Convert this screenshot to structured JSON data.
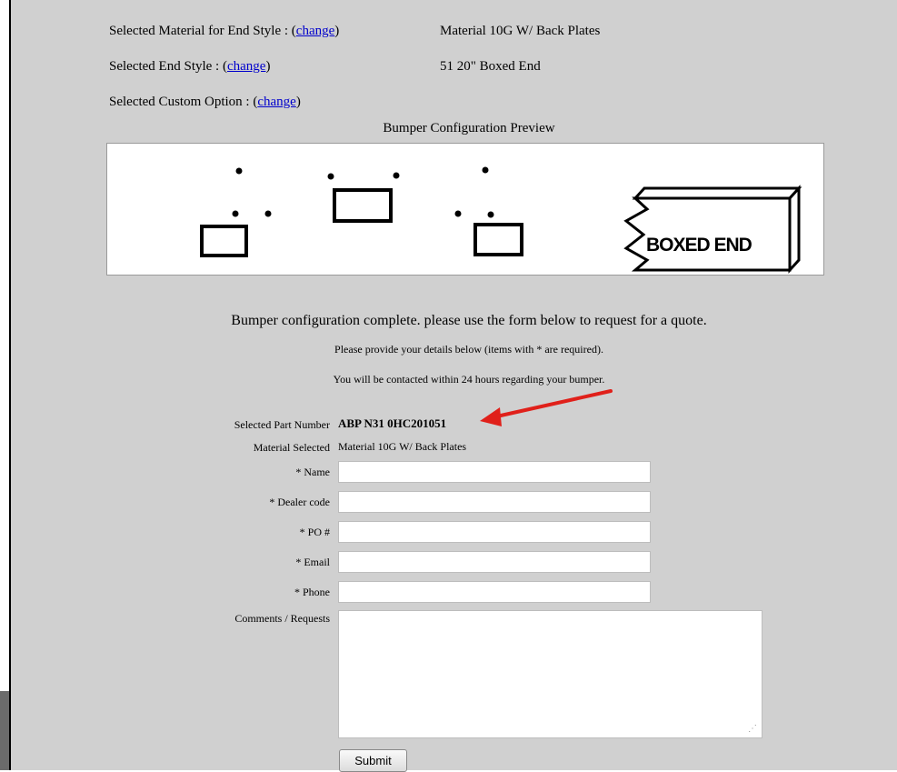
{
  "selections": [
    {
      "label": "Selected Material for End Style : (",
      "link": "change",
      "close": ")",
      "value": "Material 10G W/ Back Plates"
    },
    {
      "label": "Selected End Style : (",
      "link": "change",
      "close": ")",
      "value": "51 20\" Boxed End"
    },
    {
      "label": "Selected Custom Option : (",
      "link": "change",
      "close": ")",
      "value": ""
    }
  ],
  "preview": {
    "title": "Bumper Configuration Preview",
    "boxed_end_label": "BOXED END"
  },
  "messages": {
    "complete": "Bumper configuration complete. please use the form below to request for a quote.",
    "details": "Please provide your details below (items with * are required).",
    "contact": "You will be contacted within 24 hours regarding your bumper."
  },
  "form": {
    "part_label": "Selected Part Number",
    "part_value": "ABP N31 0HC201051",
    "material_label": "Material Selected",
    "material_value": "Material 10G W/ Back Plates",
    "name_label": "* Name",
    "name_value": "",
    "dealer_label": "* Dealer code",
    "dealer_value": "",
    "po_label": "* PO #",
    "po_value": "",
    "email_label": "* Email",
    "email_value": "",
    "phone_label": "* Phone",
    "phone_value": "",
    "comments_label": "Comments / Requests",
    "comments_value": "",
    "submit_label": "Submit"
  },
  "colors": {
    "panel_bg": "#d0d0d0",
    "link": "#0000cc",
    "annotation_arrow": "#e0201a"
  },
  "icons": {
    "arrow": "red-annotation-arrow",
    "resize": "textarea-resize-grip"
  }
}
